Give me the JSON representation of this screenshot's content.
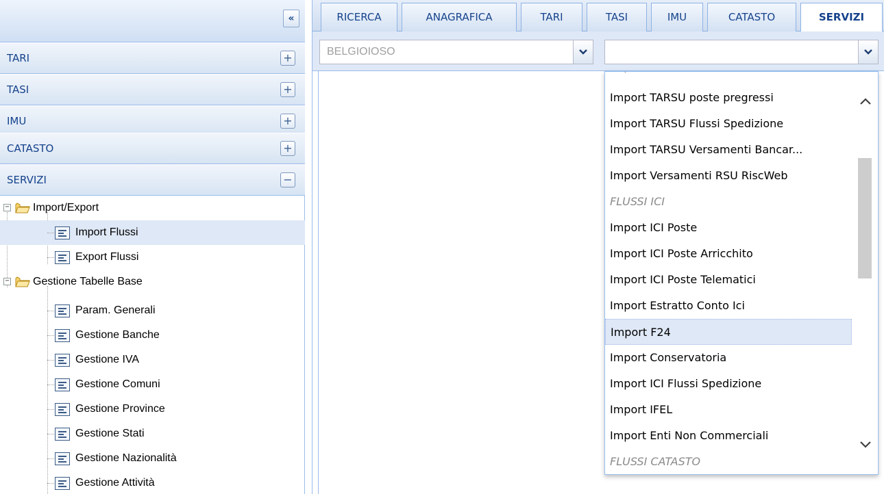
{
  "left_panel": {
    "collapse_glyph": "«",
    "sections": [
      {
        "label": "TARI",
        "toggle": "+"
      },
      {
        "label": "TASI",
        "toggle": "+"
      },
      {
        "label": "IMU",
        "toggle": "+"
      },
      {
        "label": "CATASTO",
        "toggle": "+"
      },
      {
        "label": "SERVIZI",
        "toggle": "−"
      }
    ],
    "tree": {
      "folders": [
        {
          "label": "Import/Export",
          "expander": "−",
          "items": [
            "Import Flussi",
            "Export Flussi"
          ]
        },
        {
          "label": "Gestione Tabelle Base",
          "expander": "−",
          "items": [
            "Param. Generali",
            "Gestione Banche",
            "Gestione IVA",
            "Gestione Comuni",
            "Gestione Province",
            "Gestione Stati",
            "Gestione Nazionalità",
            "Gestione Attività"
          ]
        }
      ],
      "selected": "Import Flussi"
    }
  },
  "tabs": [
    {
      "label": "RICERCA",
      "active": false
    },
    {
      "label": "ANAGRAFICA",
      "active": false
    },
    {
      "label": "TARI",
      "active": false
    },
    {
      "label": "TASI",
      "active": false
    },
    {
      "label": "IMU",
      "active": false
    },
    {
      "label": "CATASTO",
      "active": false
    },
    {
      "label": "SERVIZI",
      "active": true
    }
  ],
  "toolbar": {
    "comune_value": "BELGIOIOSO",
    "flusso_value": ""
  },
  "dropdown": {
    "partial_top": "Import Estratto Conto Tarsu",
    "items": [
      {
        "label": "Import TARSU poste pregressi",
        "type": "option"
      },
      {
        "label": "Import TARSU Flussi Spedizione",
        "type": "option"
      },
      {
        "label": "Import TARSU Versamenti Bancar...",
        "type": "option"
      },
      {
        "label": "Import Versamenti RSU RiscWeb",
        "type": "option"
      },
      {
        "label": "FLUSSI ICI",
        "type": "group"
      },
      {
        "label": "Import ICI Poste",
        "type": "option"
      },
      {
        "label": "Import ICI Poste Arricchito",
        "type": "option"
      },
      {
        "label": "Import ICI Poste Telematici",
        "type": "option"
      },
      {
        "label": "Import Estratto Conto Ici",
        "type": "option"
      },
      {
        "label": "Import F24",
        "type": "option",
        "highlighted": true
      },
      {
        "label": "Import Conservatoria",
        "type": "option"
      },
      {
        "label": "Import ICI Flussi Spedizione",
        "type": "option"
      },
      {
        "label": "Import IFEL",
        "type": "option"
      },
      {
        "label": "Import Enti Non Commerciali",
        "type": "option"
      },
      {
        "label": "FLUSSI CATASTO",
        "type": "group"
      }
    ]
  },
  "colors": {
    "header_text": "#15428b",
    "selection": "#dfe8f6",
    "group_text": "#8a8a8a",
    "disabled_text": "#a0a0a0"
  },
  "icons": [
    "collapse-left-icon",
    "expand-icon",
    "collapse-icon",
    "folder-icon",
    "form-icon",
    "chevron-down-icon",
    "chevron-up-icon"
  ]
}
